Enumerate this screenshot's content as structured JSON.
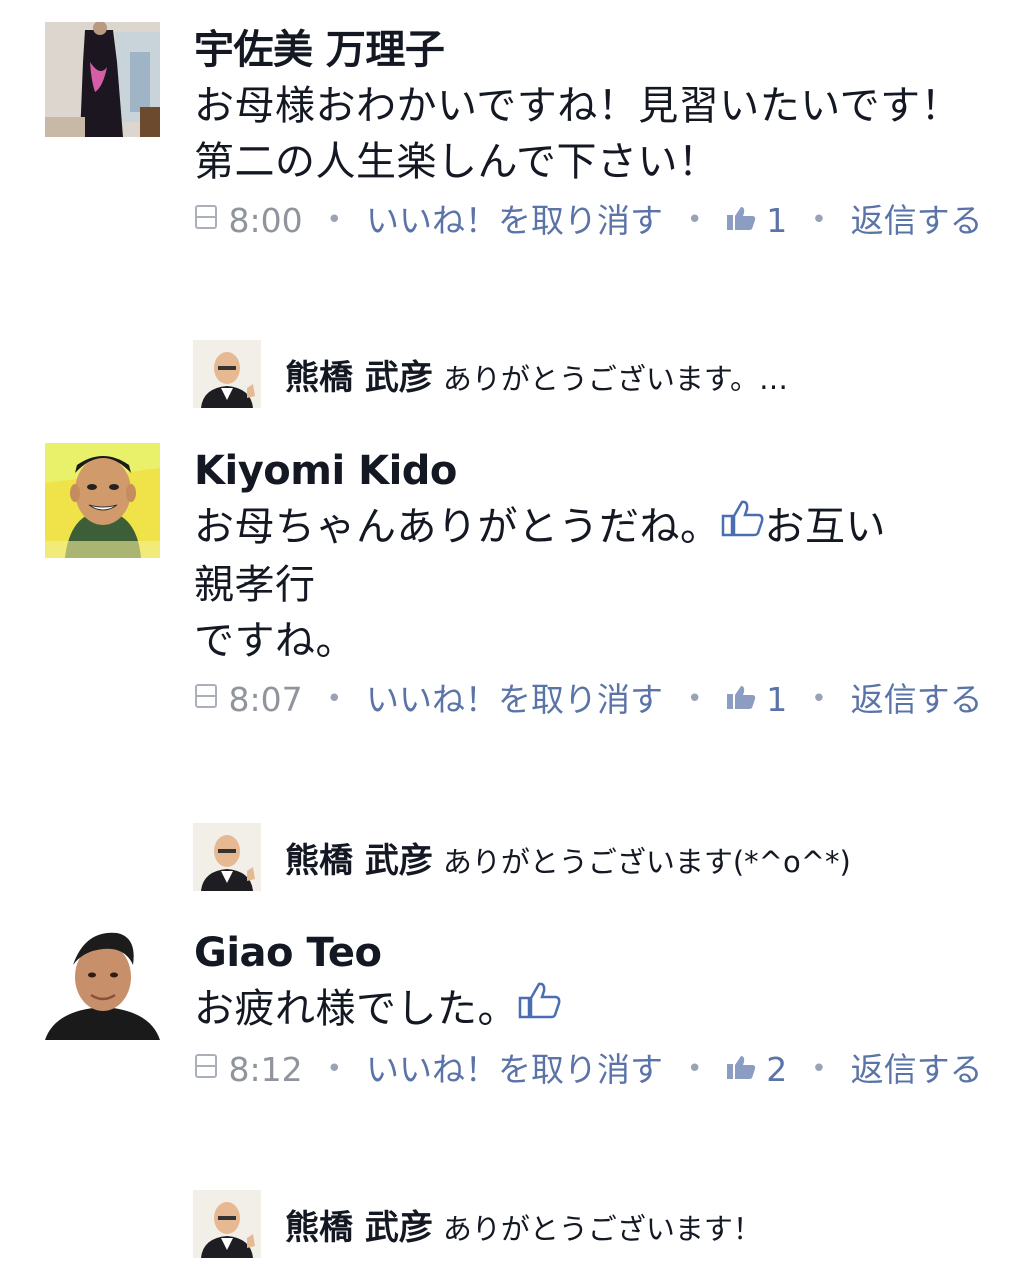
{
  "comments": [
    {
      "author": "宇佐美 万理子",
      "text": "お母様おわかいですね！見習いたいです！第二の人生楽しんで下さい！",
      "time": "8:00",
      "unlike_label": "いいね！を取り消す",
      "like_count": "1",
      "reply_label": "返信する",
      "reply": {
        "author": "熊橋 武彦",
        "text": "ありがとうございます。…"
      }
    },
    {
      "author": "Kiyomi Kido",
      "text_before": "お母ちゃんありがとうだね。",
      "text_after": "お互い\n親孝行\nですね。",
      "time": "8:07",
      "unlike_label": "いいね！を取り消す",
      "like_count": "1",
      "reply_label": "返信する",
      "reply": {
        "author": "熊橋 武彦",
        "text": "ありがとうございます(*^o^*)"
      }
    },
    {
      "author": "Giao Teo",
      "text_before": "お疲れ様でした。",
      "time": "8:12",
      "unlike_label": "いいね！を取り消す",
      "like_count": "2",
      "reply_label": "返信する",
      "reply": {
        "author": "熊橋 武彦",
        "text": "ありがとうございます！"
      }
    }
  ],
  "colors": {
    "link": "#5b74a8",
    "meta": "#90949c",
    "text": "#141823"
  },
  "icons": {
    "time": "clock-icon",
    "like": "thumbs-up-icon",
    "inline_emoji": "thumbs-up-outline-icon"
  }
}
